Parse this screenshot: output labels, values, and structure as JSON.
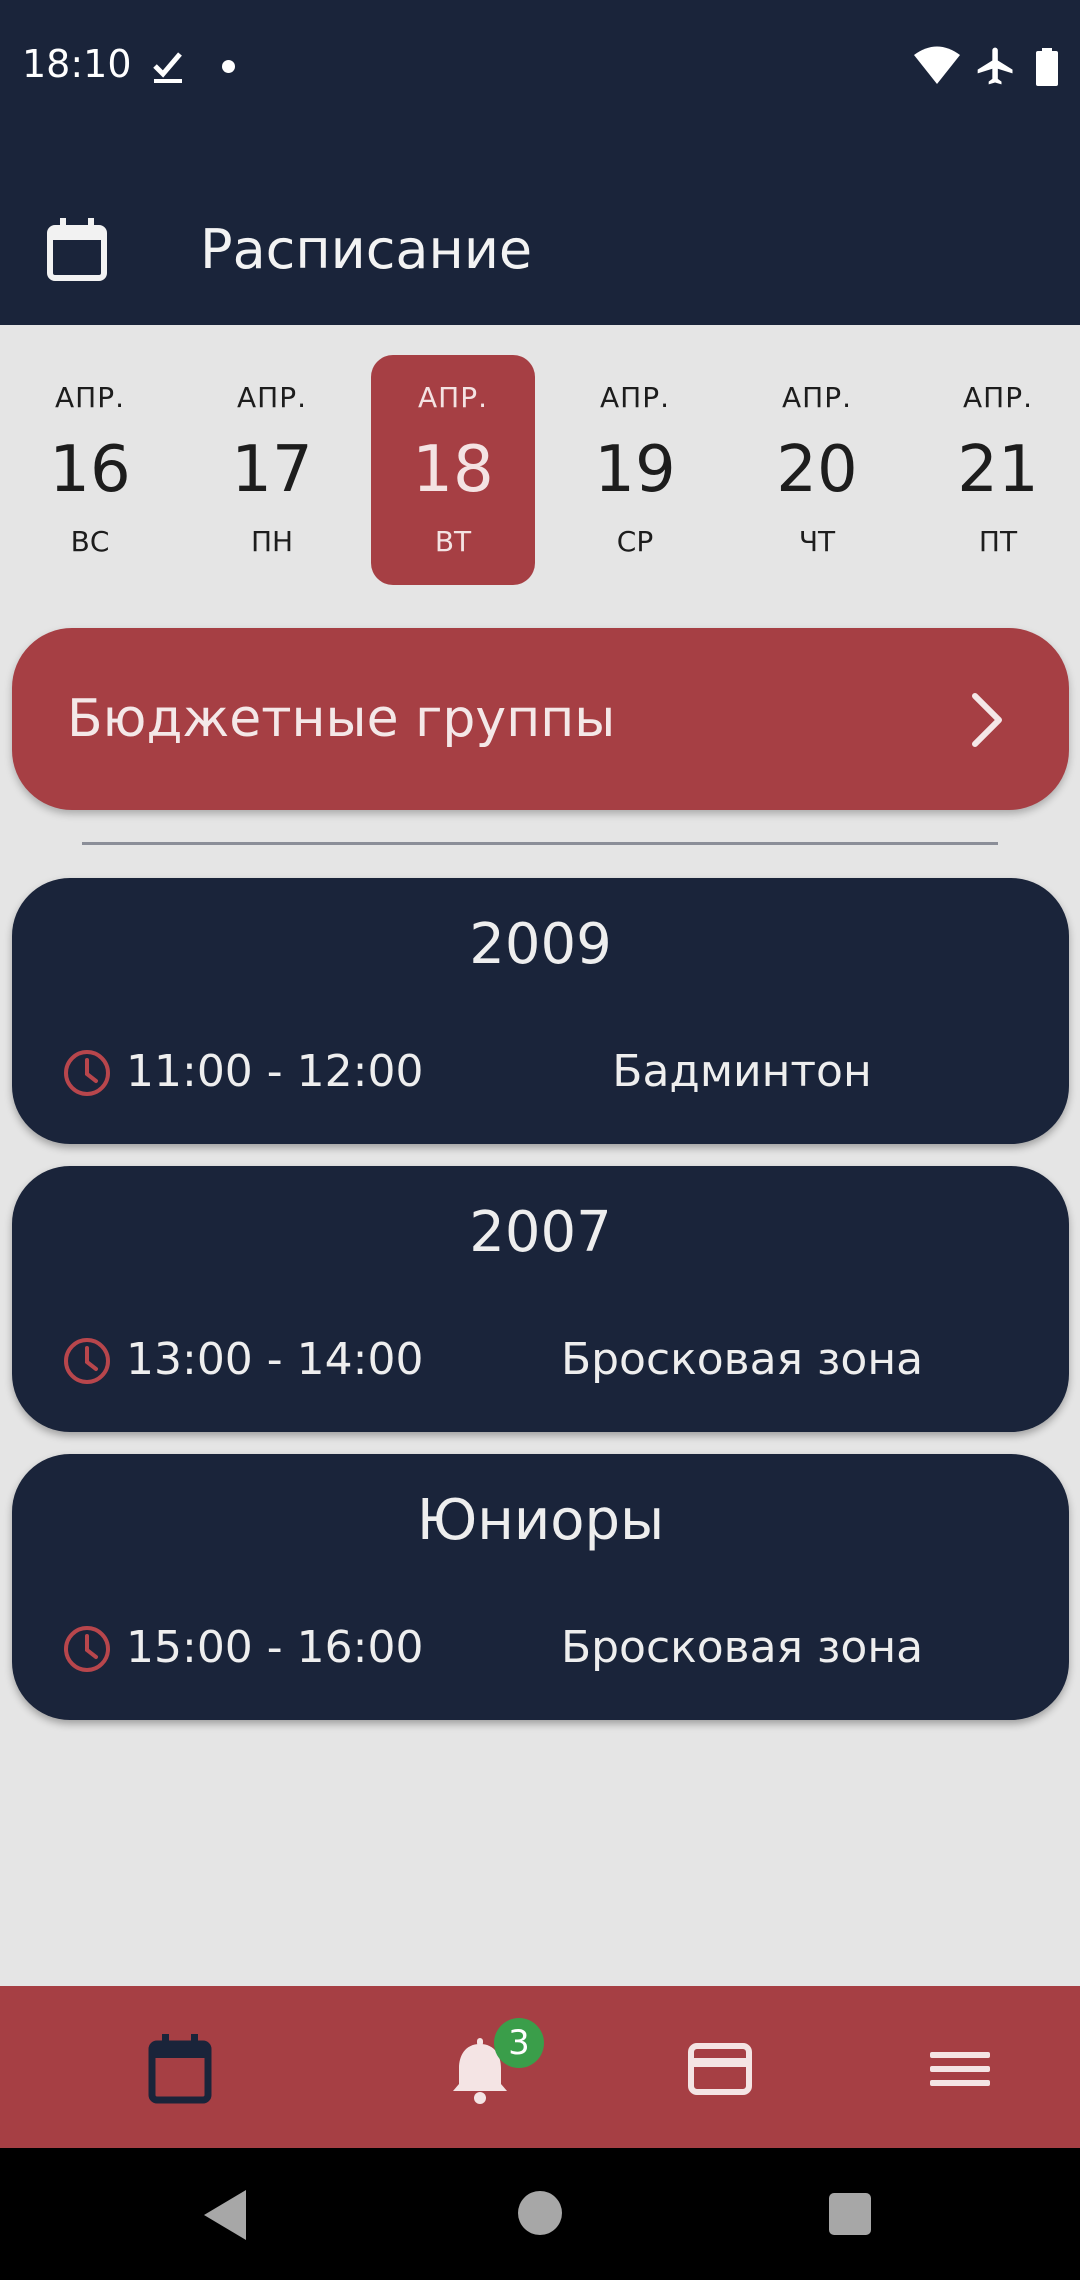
{
  "status_bar": {
    "time": "18:10",
    "icons": [
      "check-download-icon",
      "notification-dot-icon",
      "wifi-icon",
      "airplane-icon",
      "battery-icon"
    ]
  },
  "app_bar": {
    "icon": "calendar-icon",
    "title": "Расписание"
  },
  "date_strip": {
    "selected_index": 2,
    "days": [
      {
        "month": "АПР.",
        "day": "16",
        "weekday": "ВС"
      },
      {
        "month": "АПР.",
        "day": "17",
        "weekday": "ПН"
      },
      {
        "month": "АПР.",
        "day": "18",
        "weekday": "ВТ"
      },
      {
        "month": "АПР.",
        "day": "19",
        "weekday": "СР"
      },
      {
        "month": "АПР.",
        "day": "20",
        "weekday": "ЧТ"
      },
      {
        "month": "АПР.",
        "day": "21",
        "weekday": "ПТ"
      }
    ]
  },
  "budget_groups_button": {
    "label": "Бюджетные группы",
    "icon": "chevron-right-icon"
  },
  "classes": [
    {
      "group": "2009",
      "time": "11:00 - 12:00",
      "place": "Бадминтон"
    },
    {
      "group": "2007",
      "time": "13:00 - 14:00",
      "place": "Бросковая зона"
    },
    {
      "group": "Юниоры",
      "time": "15:00 - 16:00",
      "place": "Бросковая зона"
    }
  ],
  "bottom_nav": {
    "items": [
      "calendar-icon",
      "bell-icon",
      "credit-card-icon",
      "menu-icon"
    ],
    "notifications_badge": "3"
  },
  "system_nav": [
    "back-icon",
    "home-icon",
    "recents-icon"
  ],
  "colors": {
    "navy": "#1a243a",
    "accent_red": "#a63f44",
    "background": "#e5e5e5",
    "badge_green": "#3a9e4a"
  }
}
